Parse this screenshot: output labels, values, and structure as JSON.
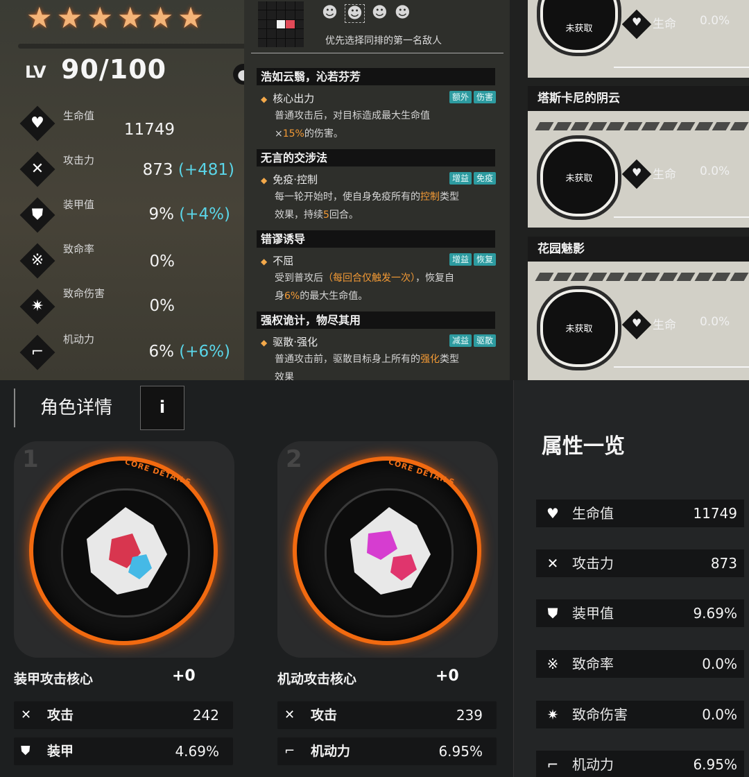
{
  "stats": {
    "stars": [
      "★",
      "★",
      "★",
      "★",
      "★",
      "★"
    ],
    "level_label": "LV",
    "level_value": "90/100",
    "rows": [
      {
        "name": "生命值",
        "value": "11749",
        "bonus": "",
        "icon": "heart-icon",
        "glyph": "♥"
      },
      {
        "name": "攻击力",
        "value": "873",
        "bonus": "(+481)",
        "icon": "crossed-swords-icon",
        "glyph": "✕"
      },
      {
        "name": "装甲值",
        "value": "9%",
        "bonus": "(+4%)",
        "icon": "shield-icon",
        "glyph": "⛊"
      },
      {
        "name": "致命率",
        "value": "0%",
        "bonus": "",
        "icon": "crit-rate-icon",
        "glyph": "※"
      },
      {
        "name": "致命伤害",
        "value": "0%",
        "bonus": "",
        "icon": "explosion-icon",
        "glyph": "✷"
      },
      {
        "name": "机动力",
        "value": "6%",
        "bonus": "(+6%)",
        "icon": "boot-icon",
        "glyph": "⌐"
      }
    ]
  },
  "skills": {
    "target_desc": "优先选择同排的第一名敌人",
    "sections": [
      {
        "title": "浩如云翳，沁若芬芳",
        "skill": "核心出力",
        "tags": [
          "额外",
          "伤害"
        ],
        "desc": [
          "普通攻击后，对目标造成最大生命值",
          "×",
          "15%",
          "的伤害。"
        ]
      },
      {
        "title": "无言的交涉法",
        "skill": "免疫·控制",
        "tags": [
          "增益",
          "免疫"
        ],
        "desc": [
          "每一轮开始时，使自身免疫所有的",
          "控制",
          "类型",
          "效果，持续",
          "5",
          "回合。"
        ]
      },
      {
        "title": "错谬诱导",
        "skill": "不屈",
        "tags": [
          "增益",
          "恢复"
        ],
        "desc": [
          "受到普攻后",
          "（每回合仅触发一次）",
          "，恢复自",
          "身",
          "6%",
          "的最大生命值。"
        ]
      },
      {
        "title": "强权诡计，物尽其用",
        "skill": "驱散·强化",
        "tags": [
          "减益",
          "驱散"
        ],
        "desc": [
          "普通攻击前，驱散目标身上所有的",
          "强化",
          "类型",
          "效果"
        ]
      }
    ]
  },
  "collection": {
    "status_text": "未获取",
    "hp_label": "生命",
    "hp_value": "0.0%",
    "cards": [
      {
        "title": ""
      },
      {
        "title": "塔斯卡尼的阴云"
      },
      {
        "title": "花园魅影"
      }
    ]
  },
  "detail": {
    "tab_label": "角色详情",
    "info_label": "i",
    "cores": [
      {
        "num": "1",
        "badge": "CORE DETAILS",
        "name": "装甲攻击核心",
        "plus": "+0",
        "stats": [
          {
            "name": "攻击",
            "value": "242",
            "icon": "crossed-swords-icon",
            "glyph": "✕"
          },
          {
            "name": "装甲",
            "value": "4.69%",
            "icon": "shield-icon",
            "glyph": "⛊"
          }
        ]
      },
      {
        "num": "2",
        "badge": "CORE DETAILS",
        "name": "机动攻击核心",
        "plus": "+0",
        "stats": [
          {
            "name": "攻击",
            "value": "239",
            "icon": "crossed-swords-icon",
            "glyph": "✕"
          },
          {
            "name": "机动力",
            "value": "6.95%",
            "icon": "boot-icon",
            "glyph": "⌐"
          }
        ]
      }
    ]
  },
  "attributes": {
    "title": "属性一览",
    "rows": [
      {
        "name": "生命值",
        "value": "11749",
        "glyph": "♥",
        "icon": "heart-icon"
      },
      {
        "name": "攻击力",
        "value": "873",
        "glyph": "✕",
        "icon": "crossed-swords-icon"
      },
      {
        "name": "装甲值",
        "value": "9.69%",
        "glyph": "⛊",
        "icon": "shield-icon"
      },
      {
        "name": "致命率",
        "value": "0.0%",
        "glyph": "※",
        "icon": "crit-rate-icon"
      },
      {
        "name": "致命伤害",
        "value": "0.0%",
        "glyph": "✷",
        "icon": "explosion-icon"
      },
      {
        "name": "机动力",
        "value": "6.95%",
        "glyph": "⌐",
        "icon": "boot-icon"
      }
    ]
  },
  "colors": {
    "accent_orange": "#f26a10",
    "bonus_cyan": "#5ad5e8",
    "tag_teal": "#2d9ba0",
    "highlight_orange": "#f39a35"
  }
}
